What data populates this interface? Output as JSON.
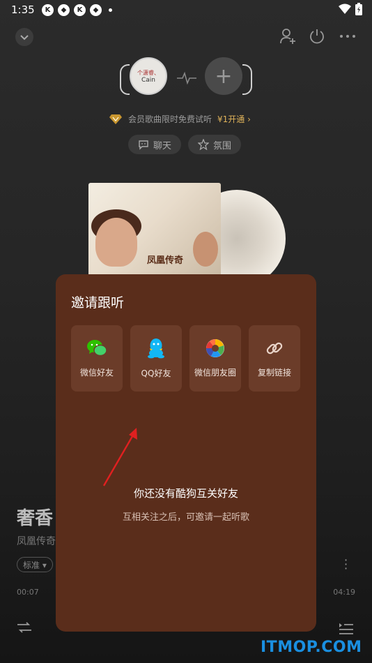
{
  "status_bar": {
    "time": "1:35",
    "app_icons": [
      "K",
      "◆",
      "K",
      "◆"
    ]
  },
  "listen_together": {
    "avatar_line1": "个潇睿、",
    "avatar_line2": "Cain",
    "add_symbol": "+"
  },
  "vip_banner": {
    "text": "会员歌曲限时免费试听",
    "open_text": "¥1开通 ›"
  },
  "chips": [
    {
      "label": "聊天",
      "icon": "chat-icon"
    },
    {
      "label": "氛围",
      "icon": "star-icon"
    }
  ],
  "album": {
    "cover_title": "凤凰传奇"
  },
  "background_player": {
    "song_title": "奢香",
    "artist": "凤凰传奇",
    "quality": "标准 ▾",
    "time_current": "00:07",
    "time_total": "04:19"
  },
  "invite_modal": {
    "title": "邀请跟听",
    "share_options": [
      {
        "label": "微信好友",
        "icon": "wechat-icon"
      },
      {
        "label": "QQ好友",
        "icon": "qq-icon"
      },
      {
        "label": "微信朋友圈",
        "icon": "moments-icon"
      },
      {
        "label": "复制链接",
        "icon": "link-icon"
      }
    ],
    "empty_title": "你还没有酷狗互关好友",
    "empty_subtitle": "互相关注之后，可邀请一起听歌"
  },
  "watermark": "ITMOP.COM",
  "colors": {
    "modal_bg": "#5a2d1b",
    "card_bg": "#6b3c29",
    "vip_gold": "#e0b35a",
    "wechat_green": "#2dc100",
    "qq_blue": "#12b7f5",
    "arrow_red": "#e02020"
  }
}
